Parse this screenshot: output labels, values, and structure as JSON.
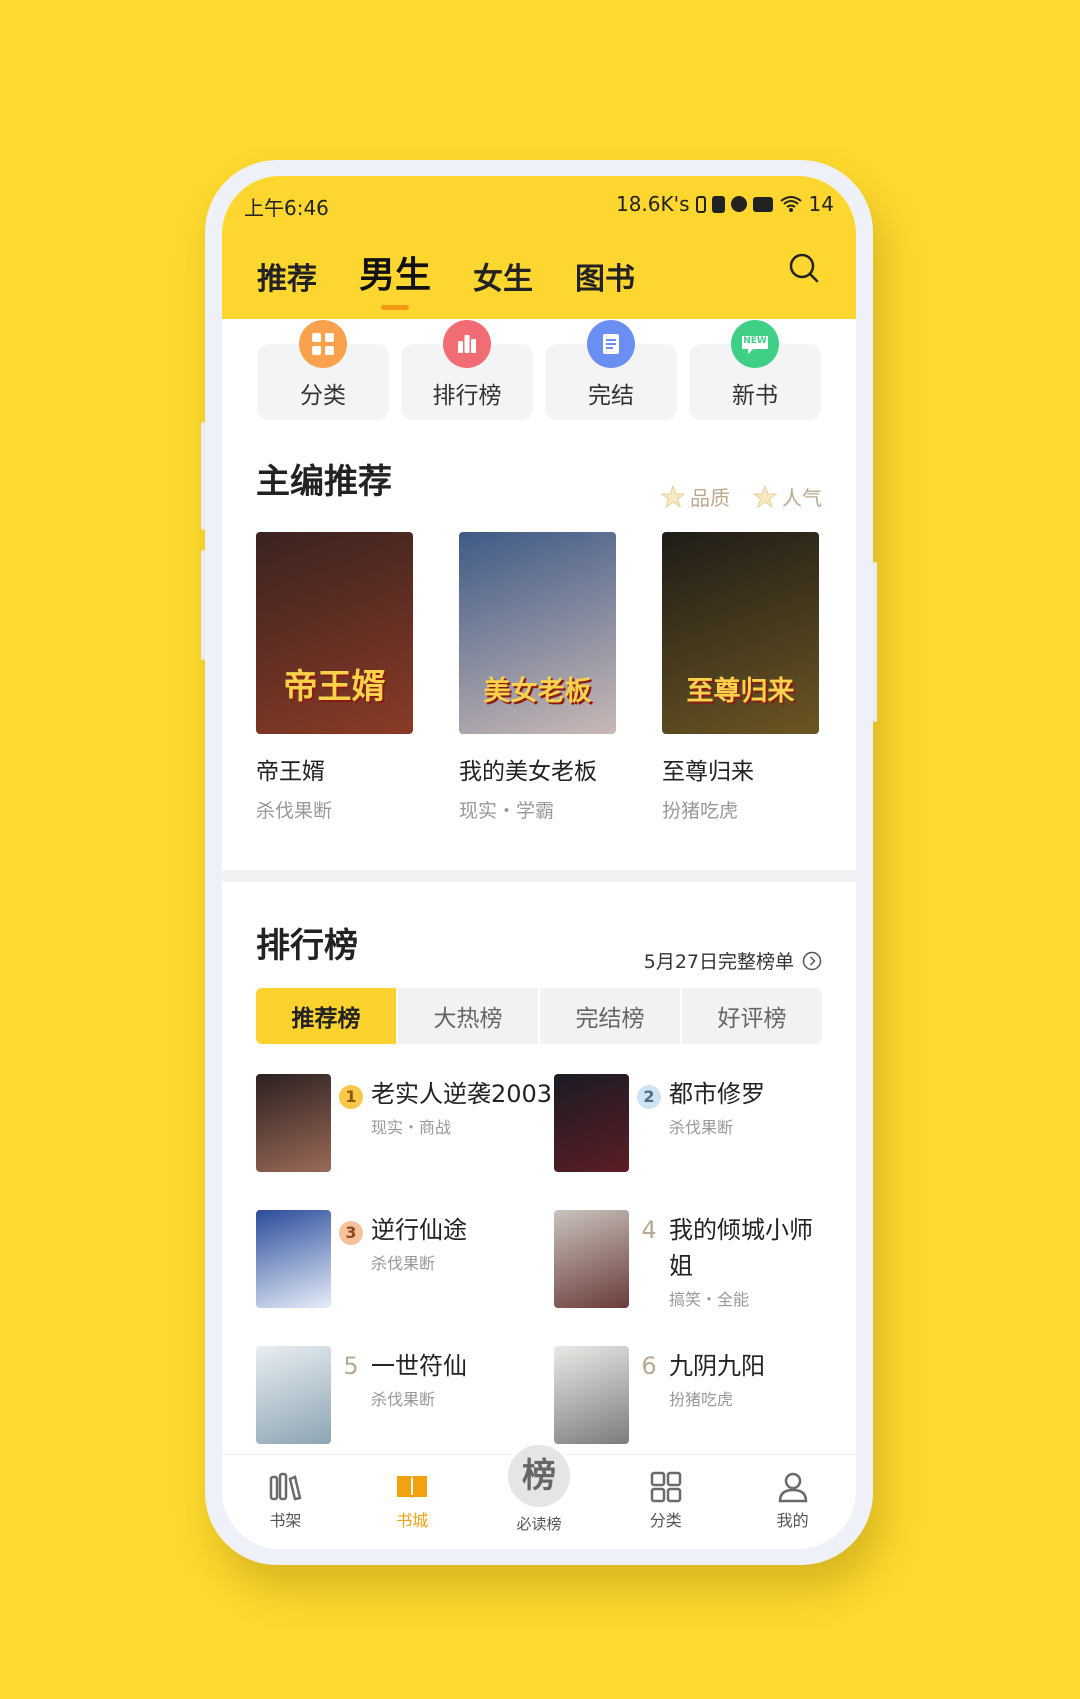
{
  "status": {
    "time": "上午6:46",
    "net": "18.6K's",
    "battery": "14"
  },
  "tabs": [
    "推荐",
    "男生",
    "女生",
    "图书"
  ],
  "active_tab": 1,
  "quick": [
    {
      "label": "分类",
      "color": "#F9A14D"
    },
    {
      "label": "排行榜",
      "color": "#F26C73"
    },
    {
      "label": "完结",
      "color": "#6B8EF2"
    },
    {
      "label": "新书",
      "color": "#3FCF86",
      "badge": "NEW"
    }
  ],
  "editor": {
    "title": "主编推荐",
    "tags": [
      "品质",
      "人气"
    ],
    "books": [
      {
        "name": "帝王婿",
        "sub": "杀伐果断",
        "cover_text": "帝王婿",
        "cover_colors": [
          "#3a2320",
          "#8a3b26"
        ]
      },
      {
        "name": "我的美女老板",
        "sub": "现实・学霸",
        "cover_text": "美女老板",
        "cover_colors": [
          "#3f5a86",
          "#c9b9b6"
        ]
      },
      {
        "name": "至尊归来",
        "sub": "扮猪吃虎",
        "cover_text": "至尊归来",
        "cover_colors": [
          "#1f1c18",
          "#6b5522"
        ]
      }
    ]
  },
  "ranking": {
    "title": "排行榜",
    "link": "5月27日完整榜单",
    "tabs": [
      "推荐榜",
      "大热榜",
      "完结榜",
      "好评榜"
    ],
    "active": 0,
    "items": [
      {
        "rank": "1",
        "name": "老实人逆袭2003",
        "sub": "现实・商战",
        "colors": [
          "#2b2020",
          "#9b6a58"
        ]
      },
      {
        "rank": "2",
        "name": "都市修罗",
        "sub": "杀伐果断",
        "colors": [
          "#1b1b25",
          "#5b1d24"
        ]
      },
      {
        "rank": "3",
        "name": "逆行仙途",
        "sub": "杀伐果断",
        "colors": [
          "#2a4b9a",
          "#e7eef8"
        ]
      },
      {
        "rank": "4",
        "name": "我的倾城小师姐",
        "sub": "搞笑・全能",
        "colors": [
          "#c9c3bd",
          "#6a3c3a"
        ]
      },
      {
        "rank": "5",
        "name": "一世符仙",
        "sub": "杀伐果断",
        "colors": [
          "#e8eef2",
          "#8da4b3"
        ]
      },
      {
        "rank": "6",
        "name": "九阴九阳",
        "sub": "扮猪吃虎",
        "colors": [
          "#e9e9e6",
          "#7c7c7c"
        ]
      }
    ]
  },
  "nav": [
    {
      "label": "书架",
      "icon": "bookshelf-icon"
    },
    {
      "label": "书城",
      "icon": "bookstore-icon"
    },
    {
      "label": "必读榜",
      "icon": "rank-icon",
      "center": "榜"
    },
    {
      "label": "分类",
      "icon": "category-icon"
    },
    {
      "label": "我的",
      "icon": "profile-icon"
    }
  ],
  "active_nav": 1
}
